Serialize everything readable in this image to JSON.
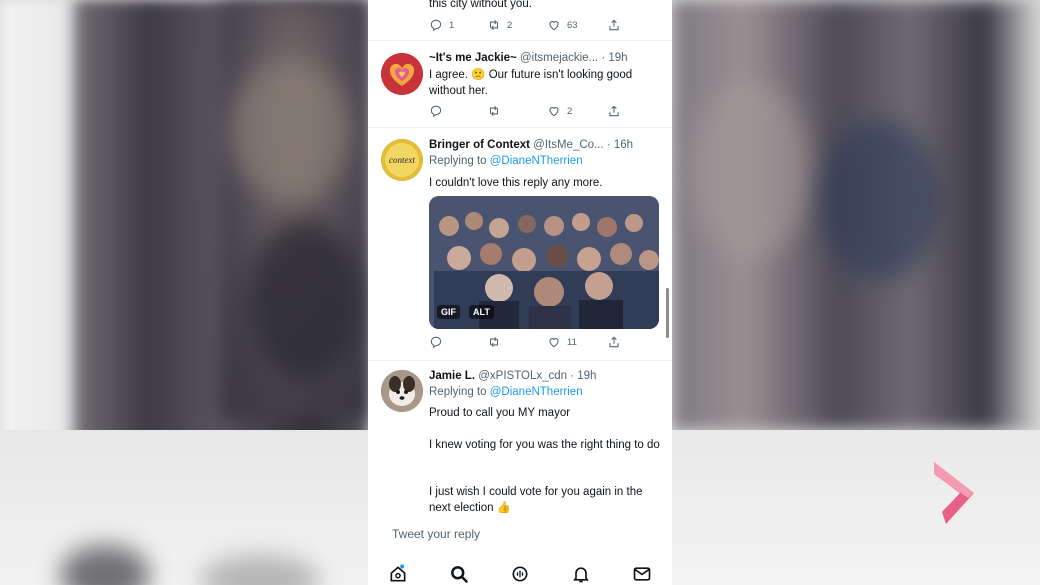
{
  "tweets": [
    {
      "partial_text": "this city without you.",
      "actions": {
        "reply": "1",
        "retweet": "2",
        "like": "63"
      }
    },
    {
      "name": "~It's me Jackie~",
      "meta": "@itsmejackie... · 19h",
      "text": "I agree. 🙁 Our future isn't looking good without her.",
      "actions": {
        "reply": "",
        "retweet": "",
        "like": "2"
      }
    },
    {
      "name": "Bringer of Context",
      "meta": "@ItsMe_Co... · 16h",
      "replying_prefix": "Replying to",
      "replying_handle": "@DianeNTherrien",
      "text": "I couldn't love this reply any more.",
      "media": {
        "gif_label": "GIF",
        "alt_label": "ALT"
      },
      "avatar_text": "context",
      "actions": {
        "reply": "",
        "retweet": "",
        "like": "11"
      }
    },
    {
      "name": "Jamie L.",
      "meta": "@xPISTOLx_cdn · 19h",
      "replying_prefix": "Replying to",
      "replying_handle": "@DianeNTherrien",
      "paragraphs": [
        "Proud to call you MY mayor",
        "I knew voting for you was the right thing to do",
        "I just wish I could vote for you again in the next election 👍"
      ]
    }
  ],
  "reply_box": {
    "placeholder": "Tweet your reply"
  },
  "tabs": [
    "home-icon",
    "search-icon",
    "spaces-icon",
    "bell-icon",
    "mail-icon"
  ],
  "colors": {
    "accent": "#1d9bf0",
    "text": "#0f1419",
    "muted": "#536471",
    "broadcaster_logo": "#e8608a"
  }
}
